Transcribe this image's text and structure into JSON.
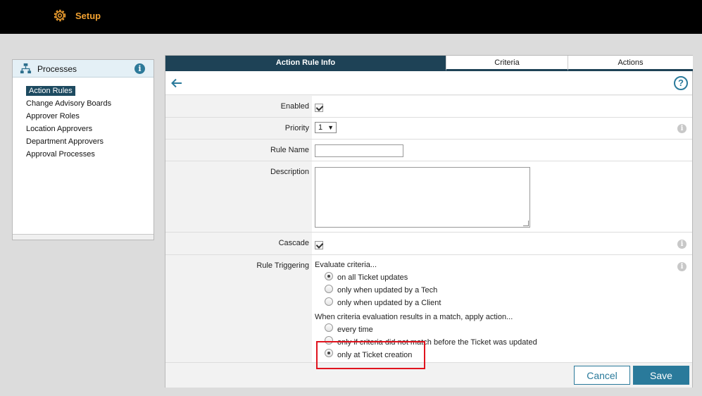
{
  "header": {
    "title": "Setup"
  },
  "sidebar": {
    "title": "Processes",
    "items": [
      {
        "label": "Action Rules"
      },
      {
        "label": "Change Advisory Boards"
      },
      {
        "label": "Approver Roles"
      },
      {
        "label": "Location Approvers"
      },
      {
        "label": "Department Approvers"
      },
      {
        "label": "Approval Processes"
      }
    ],
    "active_index": 0
  },
  "tabs": [
    {
      "label": "Action Rule Info"
    },
    {
      "label": "Criteria"
    },
    {
      "label": "Actions"
    }
  ],
  "form": {
    "enabled": {
      "label": "Enabled",
      "checked": true
    },
    "priority": {
      "label": "Priority",
      "value": "1"
    },
    "rule_name": {
      "label": "Rule Name",
      "value": ""
    },
    "description": {
      "label": "Description",
      "value": ""
    },
    "cascade": {
      "label": "Cascade",
      "checked": true
    },
    "rule_triggering": {
      "label": "Rule Triggering",
      "evaluate_heading": "Evaluate criteria...",
      "evaluate_options": [
        {
          "label": "on all Ticket updates",
          "selected": true
        },
        {
          "label": "only when updated by a Tech",
          "selected": false
        },
        {
          "label": "only when updated by a Client",
          "selected": false
        }
      ],
      "apply_heading": "When criteria evaluation results in a match, apply action...",
      "apply_options": [
        {
          "label": "every time",
          "selected": false
        },
        {
          "label": "only if criteria did not match before the Ticket was updated",
          "selected": false
        },
        {
          "label": "only at Ticket creation",
          "selected": true
        }
      ]
    }
  },
  "footer": {
    "cancel_label": "Cancel",
    "save_label": "Save"
  },
  "colors": {
    "accent": "#2a7a9b",
    "topbar": "#000000",
    "title_orange": "#f0a030",
    "highlight_red": "#e0141e"
  }
}
